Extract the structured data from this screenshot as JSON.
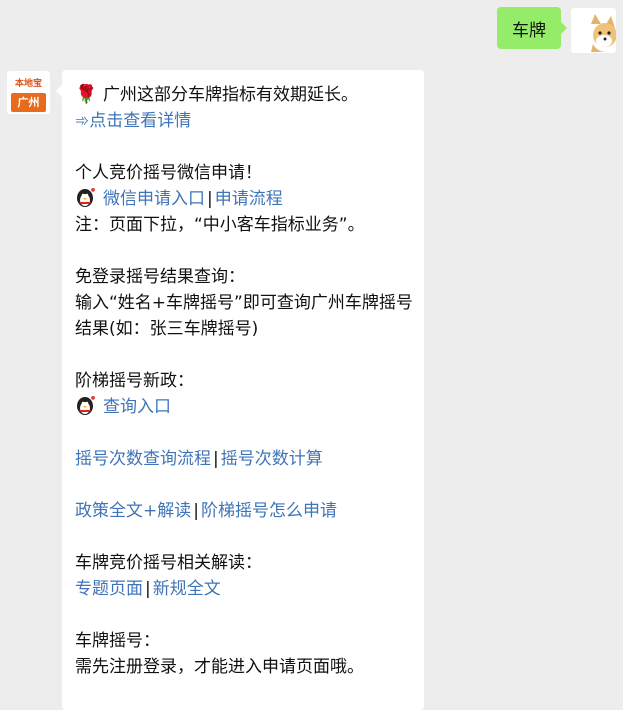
{
  "sent": {
    "text": "车牌"
  },
  "bot_avatar": {
    "top": "本地宝",
    "bottom": "广州"
  },
  "message": {
    "rose_icon": "🌹",
    "headline": "广州这部分车牌指标有效期延长。",
    "detail_arrow": "➾",
    "detail_link": "点击查看详情",
    "wechat_title": "个人竞价摇号微信申请！",
    "wechat_link1": "微信申请入口",
    "wechat_sep": "|",
    "wechat_link2": "申请流程",
    "wechat_note": "注：页面下拉，“中小客车指标业务”。",
    "query_title": "免登录摇号结果查询：",
    "query_text": "输入“姓名+车牌摇号”即可查询广州车牌摇号结果(如：张三车牌摇号)",
    "ladder_title": "阶梯摇号新政：",
    "ladder_link": "查询入口",
    "count_link1": "摇号次数查询流程",
    "count_sep": "|",
    "count_link2": "摇号次数计算",
    "policy_link1": "政策全文+解读",
    "policy_sep": "|",
    "policy_link2": "阶梯摇号怎么申请",
    "bid_title": "车牌竞价摇号相关解读：",
    "bid_link1": "专题页面",
    "bid_sep": "|",
    "bid_link2": "新规全文",
    "plate_title": "车牌摇号：",
    "plate_text": "需先注册登录，才能进入申请页面哦。"
  },
  "colors": {
    "link": "#3f74b8",
    "sent_bubble": "#95ec69",
    "background": "#ededed"
  }
}
